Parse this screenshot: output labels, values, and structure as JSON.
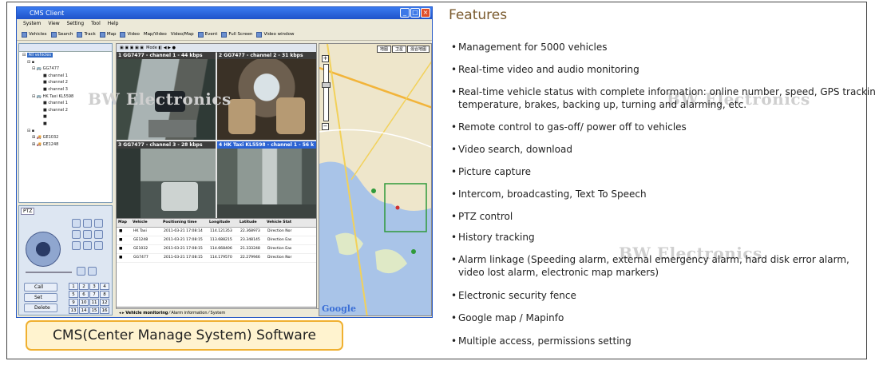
{
  "window": {
    "title": "CMS Client",
    "menu": [
      "System",
      "View",
      "Setting",
      "Tool",
      "Help"
    ],
    "toolbar": [
      "Vehicles",
      "Search",
      "Track",
      "Map",
      "Video",
      "Map/Video",
      "Video/Map",
      "Event",
      "Full Screen",
      "Video window"
    ]
  },
  "tree": {
    "items": [
      "All vehicles",
      "GG7477",
      "channel 1",
      "channel 2",
      "channel 3",
      "HK Taxi KL5598",
      "channel 1",
      "channel 2",
      "GE1032",
      "GE1248"
    ]
  },
  "ptz": {
    "label": "PTZ",
    "actions": [
      "Call",
      "Set",
      "Delete"
    ],
    "numbers": [
      "1",
      "2",
      "3",
      "4",
      "5",
      "6",
      "7",
      "8",
      "9",
      "10",
      "11",
      "12",
      "13",
      "14",
      "15",
      "16"
    ]
  },
  "video": {
    "toolbar_label": "Mode",
    "channels": [
      "1  GG7477 - channel 1 - 44 kbps",
      "2  GG7477 - channel 2 - 31 kbps",
      "3  GG7477 - channel 3 - 28 kbps",
      "4  HK Taxi KL5598 - channel 1 - 56 k"
    ]
  },
  "table": {
    "headers": [
      "Map",
      "Vehicle",
      "Positioning time",
      "Longitude",
      "Latitude",
      "Vehicle Stat"
    ],
    "rows": [
      [
        "HK Taxi",
        "2011-03-21 17:08:14",
        "114.121353",
        "22.368973",
        "Direction Nor"
      ],
      [
        "GE1248",
        "2011-03-21 17:08:15",
        "113.688215",
        "23.348145",
        "Direction Eas"
      ],
      [
        "GE1032",
        "2011-03-21 17:08:15",
        "114.668406",
        "21.333248",
        "Direction Eas"
      ],
      [
        "GG7477",
        "2011-03-21 17:08:15",
        "114.179570",
        "22.279946",
        "Direction Nor"
      ]
    ],
    "tabs": [
      "Vehicle monitoring",
      "Alarm information",
      "System"
    ]
  },
  "map": {
    "buttons": [
      "地图",
      "卫星",
      "混合地图"
    ],
    "logo": "Google"
  },
  "caption": "CMS(Center Manage System) Software",
  "watermark": "BW Electronics",
  "features": {
    "title": "Features",
    "items": [
      "Management for 5000 vehicles",
      "Real-time video and audio monitoring",
      "Real-time vehicle status with complete information: online number, speed, GPS tracking,",
      "temperature, brakes, backing up, turning and alarming, etc.",
      "Remote control to gas-off/ power off to vehicles",
      "Video search, download",
      "Picture capture",
      "Intercom, broadcasting, Text To Speech",
      "PTZ control",
      "History tracking",
      "Alarm linkage (Speeding alarm, external emergency alarm, hard disk error alarm,",
      "video lost alarm, electronic map markers)",
      "Electronic security fence",
      "Google map / Mapinfo",
      "Multiple access, permissions setting"
    ]
  }
}
